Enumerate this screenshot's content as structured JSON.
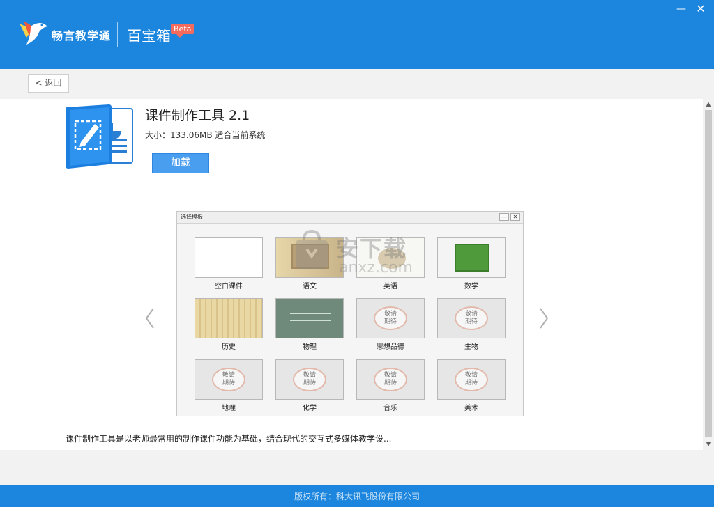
{
  "header": {
    "brand": "畅言教学通",
    "app_title": "百宝箱",
    "badge": "Beta",
    "minimize": "—",
    "close": "✕"
  },
  "toolbar": {
    "back_label": "< 返回"
  },
  "tool": {
    "name": "课件制作工具 2.1",
    "size_text": "大小：133.06MB 适合当前系统",
    "load_label": "加载",
    "description": "课件制作工具是以老师最常用的制作课件功能为基础，结合现代的交互式多媒体教学设..."
  },
  "preview": {
    "window_title": "选择模板",
    "min_label": "—",
    "close_label": "✕",
    "coming_soon": [
      "敬请",
      "期待"
    ],
    "templates": [
      {
        "label": "空白课件",
        "style": "blank"
      },
      {
        "label": "语文",
        "style": "chinese"
      },
      {
        "label": "英语",
        "style": "english"
      },
      {
        "label": "数学",
        "style": "math"
      },
      {
        "label": "历史",
        "style": "history"
      },
      {
        "label": "物理",
        "style": "physics"
      },
      {
        "label": "思想品德",
        "style": "coming"
      },
      {
        "label": "生物",
        "style": "coming"
      },
      {
        "label": "地理",
        "style": "coming"
      },
      {
        "label": "化学",
        "style": "coming"
      },
      {
        "label": "音乐",
        "style": "coming"
      },
      {
        "label": "美术",
        "style": "coming"
      }
    ]
  },
  "watermark": {
    "text": "安下载",
    "sub": "anxz.com"
  },
  "footer": {
    "copyright": "版权所有：科大讯飞股份有限公司"
  },
  "colors": {
    "accent": "#1c86de",
    "button": "#4a9ef0"
  }
}
